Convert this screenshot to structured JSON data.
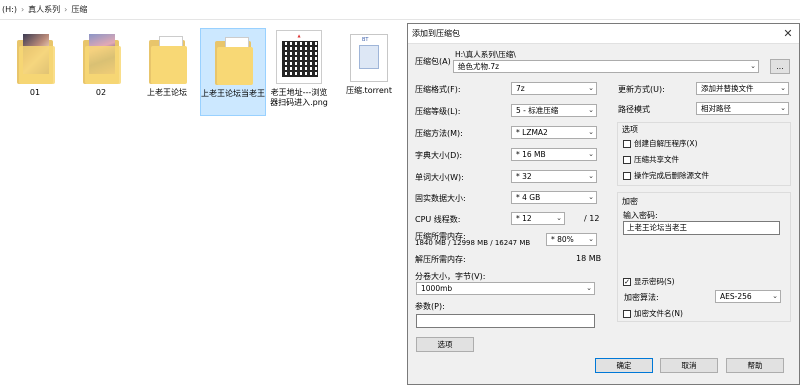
{
  "breadcrumb": [
    "(H:)",
    "真人系列",
    "压缩"
  ],
  "files": [
    {
      "name": "01",
      "kind": "folder"
    },
    {
      "name": "02",
      "kind": "folder"
    },
    {
      "name": "上老王论坛",
      "kind": "folder"
    },
    {
      "name": "上老王论坛当老王",
      "kind": "folder",
      "selected": true
    },
    {
      "name": "老王地址---浏览器扫码进入.png",
      "kind": "png"
    },
    {
      "name": "压缩.torrent",
      "kind": "torrent",
      "badge": "BT"
    }
  ],
  "dialog": {
    "title": "添加到压缩包",
    "close": "✕",
    "archive_label": "压缩包(A)",
    "archive_path": "H:\\真人系列\\压缩\\",
    "archive_name": "绝色尤物.7z",
    "browse": "...",
    "format_label": "压缩格式(F):",
    "format_value": "7z",
    "level_label": "压缩等级(L):",
    "level_value": "5 - 标准压缩",
    "method_label": "压缩方法(M):",
    "method_value": "* LZMA2",
    "dict_label": "字典大小(D):",
    "dict_value": "* 16 MB",
    "word_label": "单词大小(W):",
    "word_value": "* 32",
    "solid_label": "固实数据大小:",
    "solid_value": "* 4 GB",
    "cpu_label": "CPU 线程数:",
    "cpu_value": "* 12",
    "cpu_total": "/ 12",
    "mem_label": "压缩所需内存:",
    "mem_detail": "1840 MB / 12998 MB / 16247 MB",
    "mem_percent": "* 80%",
    "decomp_label": "解压所需内存:",
    "decomp_value": "18 MB",
    "split_label": "分卷大小，字节(V):",
    "split_value": "1000mb",
    "params_label": "参数(P):",
    "params_value": "",
    "options_button": "选项",
    "update_label": "更新方式(U):",
    "update_value": "添加并替换文件",
    "path_label": "路径模式",
    "path_value": "相对路径",
    "options_group": "选项",
    "opt_sfx": "创建自解压程序(X)",
    "opt_shared": "压缩共享文件",
    "opt_delete": "操作完成后删除源文件",
    "encrypt_group": "加密",
    "password_label": "输入密码:",
    "password_value": "上老王论坛当老王",
    "show_password": "显示密码(S)",
    "enc_method_label": "加密算法:",
    "enc_method_value": "AES-256",
    "encrypt_names": "加密文件名(N)",
    "ok": "确定",
    "cancel": "取消",
    "help": "帮助"
  }
}
